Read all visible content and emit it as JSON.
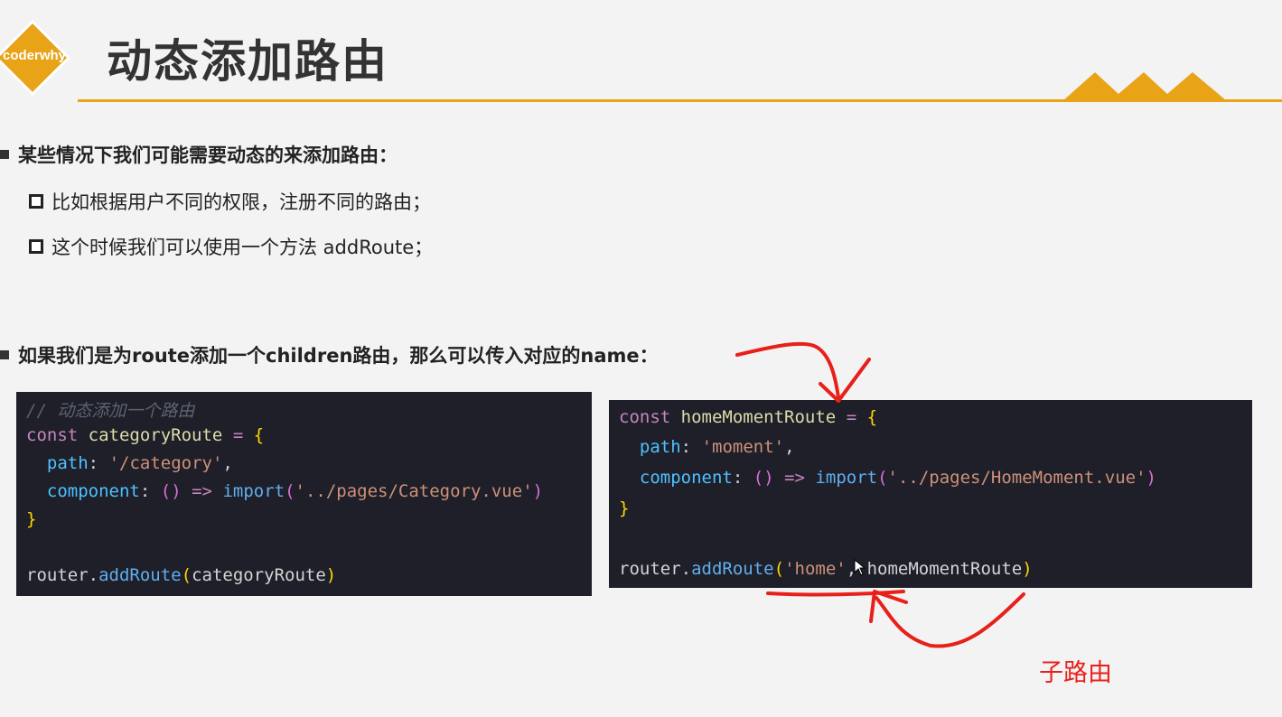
{
  "logo": {
    "text": "coderwhy",
    "color": "#e8a317"
  },
  "title": "动态添加路由",
  "bullets": {
    "b1": "某些情况下我们可能需要动态的来添加路由：",
    "b1_sub1": "比如根据用户不同的权限，注册不同的路由；",
    "b1_sub2": "这个时候我们可以使用一个方法 addRoute；",
    "b2": "如果我们是为route添加一个children路由，那么可以传入对应的name："
  },
  "code_left": {
    "comment": "// 动态添加一个路由",
    "const_kw": "const",
    "var_name": "categoryRoute",
    "path_key": "path",
    "path_val": "'/category'",
    "component_key": "component",
    "import_kw": "import",
    "import_val": "'../pages/Category.vue'",
    "router": "router",
    "method": "addRoute",
    "arg": "categoryRoute"
  },
  "code_right": {
    "const_kw": "const",
    "var_name": "homeMomentRoute",
    "path_key": "path",
    "path_val": "'moment'",
    "component_key": "component",
    "import_kw": "import",
    "import_val": "'../pages/HomeMoment.vue'",
    "router": "router",
    "method": "addRoute",
    "parent_name": "'home'",
    "arg": "homeMomentRoute"
  },
  "annotation": {
    "text": "子路由",
    "color": "#e8201a"
  },
  "colors": {
    "accent": "#e8a317",
    "code_bg": "#1e1f29"
  }
}
